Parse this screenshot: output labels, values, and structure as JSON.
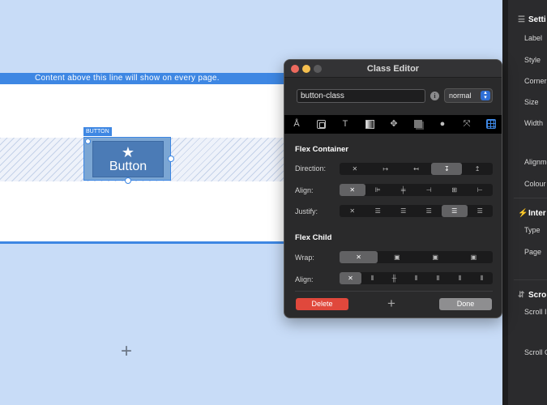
{
  "canvas": {
    "banner_text": "Content above this line will show on every page.",
    "selection_label": "BUTTON",
    "button": {
      "icon": "star-icon",
      "label": "Button"
    },
    "add_glyph": "+"
  },
  "class_editor": {
    "title": "Class Editor",
    "class_name": "button-class",
    "info_glyph": "i",
    "state": "normal",
    "tools": [
      {
        "name": "typography-tool-icon",
        "glyph": "A"
      },
      {
        "name": "box-tool-icon",
        "glyph": ""
      },
      {
        "name": "text-tool-icon",
        "glyph": "T"
      },
      {
        "name": "gradient-tool-icon",
        "glyph": ""
      },
      {
        "name": "position-tool-icon",
        "glyph": "✥"
      },
      {
        "name": "shadow-tool-icon",
        "glyph": ""
      },
      {
        "name": "effects-tool-icon",
        "glyph": "●"
      },
      {
        "name": "transform-tool-icon",
        "glyph": "⤧"
      },
      {
        "name": "layout-tool-icon",
        "glyph": ""
      }
    ],
    "flex_container": {
      "title": "Flex Container",
      "direction": {
        "label": "Direction:",
        "options": [
          "✕",
          "↦",
          "↤",
          "↧",
          "↥"
        ],
        "selected": 3
      },
      "align": {
        "label": "Align:",
        "options": [
          "✕",
          "⊫",
          "╪",
          "⊣",
          "⊞",
          "⊢"
        ],
        "selected": 0
      },
      "justify": {
        "label": "Justify:",
        "options": [
          "✕",
          "☰",
          "☰",
          "☰",
          "☰",
          "☰"
        ],
        "selected": 4
      }
    },
    "flex_child": {
      "title": "Flex Child",
      "wrap": {
        "label": "Wrap:",
        "options": [
          "✕",
          "▣",
          "▣",
          "▣"
        ],
        "selected": 0
      },
      "align": {
        "label": "Align:",
        "options": [
          "✕",
          "⦀",
          "╫",
          "⦀",
          "Ⅱ",
          "⦀",
          "⦀"
        ],
        "selected": 0
      }
    },
    "delete_label": "Delete",
    "add_glyph": "+",
    "done_label": "Done"
  },
  "inspector": {
    "settings_head": "Setti",
    "items": [
      "Label",
      "Style",
      "Corners",
      "Size",
      "Width",
      "Alignmen",
      "Colour"
    ],
    "interactions_head": "Inter",
    "interaction_items": [
      "Type",
      "Page"
    ],
    "scroll_head": "Scro",
    "scroll_items": [
      "Scroll In",
      "Scroll Ou"
    ]
  }
}
